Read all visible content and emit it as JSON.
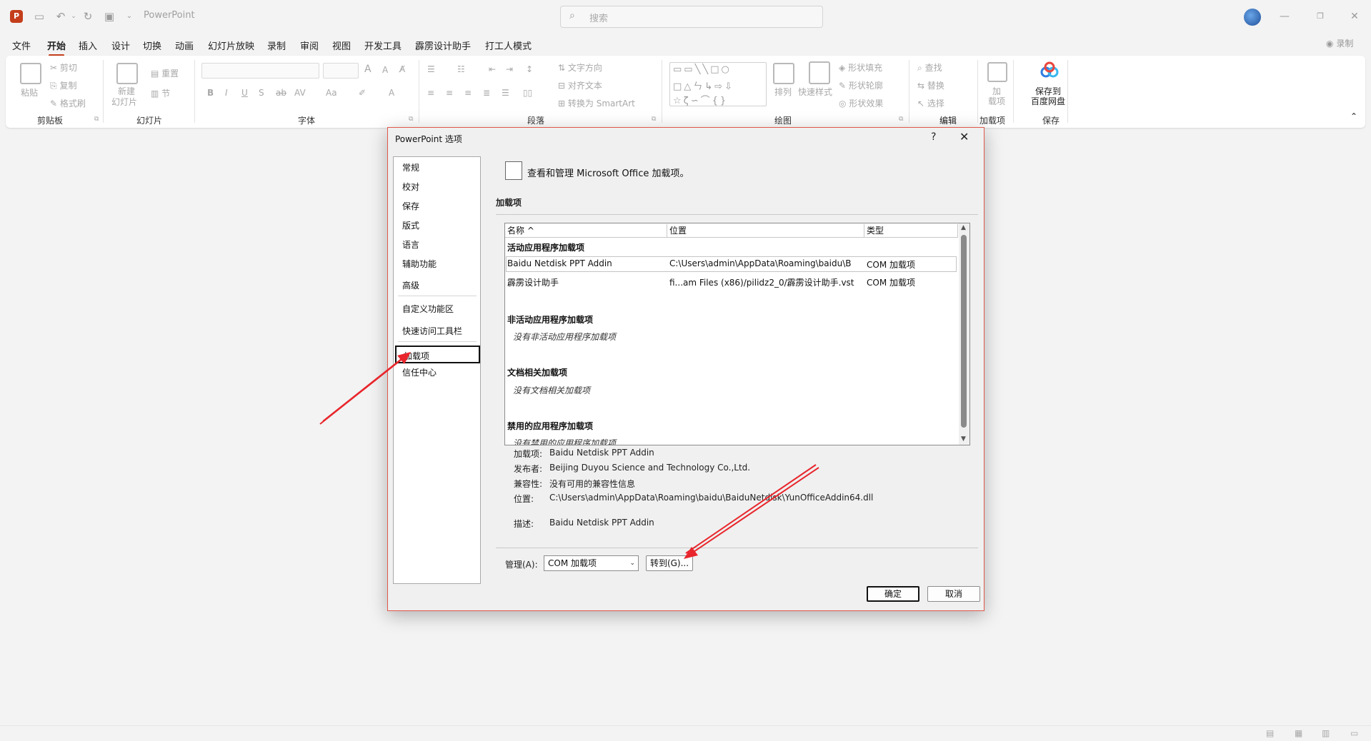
{
  "app": {
    "title": "PowerPoint",
    "logo_letter": "P"
  },
  "search": {
    "placeholder": "搜索"
  },
  "tabs": [
    "文件",
    "开始",
    "插入",
    "设计",
    "切换",
    "动画",
    "幻灯片放映",
    "录制",
    "审阅",
    "视图",
    "开发工具",
    "霹雳设计助手",
    "打工人模式"
  ],
  "active_tab": "开始",
  "record_button": "录制",
  "ribbon": {
    "clipboard": {
      "paste": "粘贴",
      "cut": "剪切",
      "copy": "复制",
      "format_painter": "格式刷",
      "label": "剪贴板"
    },
    "slides": {
      "new_slide_line1": "新建",
      "new_slide_line2": "幻灯片",
      "reset": "重置",
      "section": "节",
      "label": "幻灯片"
    },
    "font": {
      "label": "字体",
      "bold": "B",
      "italic": "I",
      "underline": "U",
      "strike": "ab",
      "spacing": "AV",
      "case": "Aa",
      "grow": "A",
      "shrink": "A",
      "fontcolor": "A"
    },
    "paragraph": {
      "text_direction": "文字方向",
      "align_text": "对齐文本",
      "smartart": "转换为 SmartArt",
      "label": "段落"
    },
    "drawing": {
      "arrange": "排列",
      "quick_styles": "快速样式",
      "shape_fill": "形状填充",
      "shape_outline": "形状轮廓",
      "shape_effects": "形状效果",
      "label": "绘图"
    },
    "editing": {
      "find": "查找",
      "replace": "替换",
      "select": "选择",
      "label": "编辑"
    },
    "addins": {
      "line1": "加",
      "line2": "载项",
      "label": "加载项"
    },
    "save": {
      "line1": "保存到",
      "line2": "百度网盘",
      "label": "保存"
    }
  },
  "dialog": {
    "title": "PowerPoint 选项",
    "help": "?",
    "close": "✕",
    "nav": [
      "常规",
      "校对",
      "保存",
      "版式",
      "语言",
      "辅助功能",
      "高级",
      "自定义功能区",
      "快速访问工具栏",
      "加载项",
      "信任中心"
    ],
    "selected_nav": "加载项",
    "header": "查看和管理 Microsoft Office 加载项。",
    "section_title": "加载项",
    "columns": {
      "name": "名称 ^",
      "location": "位置",
      "type": "类型"
    },
    "groups": {
      "active": "活动应用程序加载项",
      "inactive": "非活动应用程序加载项",
      "inactive_none": "没有非活动应用程序加载项",
      "document": "文档相关加载项",
      "document_none": "没有文档相关加载项",
      "disabled": "禁用的应用程序加载项",
      "disabled_none": "没有禁用的应用程序加载项"
    },
    "rows": [
      {
        "name": "Baidu Netdisk PPT Addin",
        "location": "C:\\Users\\admin\\AppData\\Roaming\\baidu\\B",
        "type": "COM 加载项"
      },
      {
        "name": "霹雳设计助手",
        "location": "fi...am Files (x86)/pilidz2_0/霹雳设计助手.vst",
        "type": "COM 加载项"
      }
    ],
    "details": {
      "addin_label": "加载项:",
      "addin": "Baidu Netdisk PPT Addin",
      "publisher_label": "发布者:",
      "publisher": "Beijing Duyou Science and Technology Co.,Ltd.",
      "compat_label": "兼容性:",
      "compat": "没有可用的兼容性信息",
      "location_label": "位置:",
      "location": "C:\\Users\\admin\\AppData\\Roaming\\baidu\\BaiduNetdisk\\YunOfficeAddin64.dll",
      "desc_label": "描述:",
      "desc": "Baidu Netdisk PPT Addin"
    },
    "manage_label": "管理(A):",
    "manage_value": "COM 加载项",
    "go_button": "转到(G)...",
    "ok": "确定",
    "cancel": "取消"
  },
  "colors": {
    "accent": "#c43e1c",
    "annotation": "#e8262c"
  }
}
